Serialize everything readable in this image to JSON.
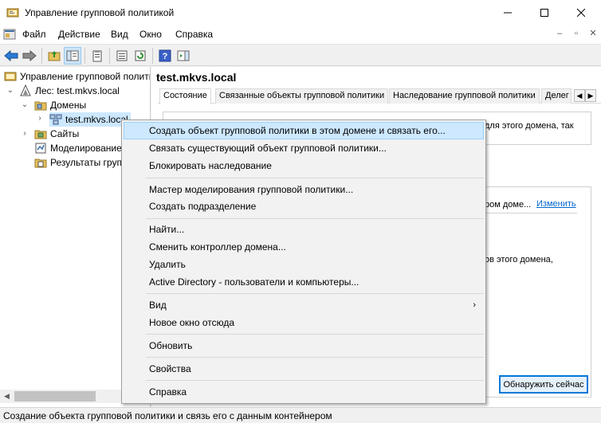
{
  "window": {
    "title": "Управление групповой политикой"
  },
  "menubar": {
    "items": [
      "Файл",
      "Действие",
      "Вид",
      "Окно",
      "Справка"
    ]
  },
  "tree": {
    "root": "Управление групповой полити",
    "forest": "Лес: test.mkvs.local",
    "domains": "Домены",
    "domain": "test.mkvs.local",
    "sites": "Сайты",
    "modeling": "Моделирование",
    "results": "Результаты груп"
  },
  "right": {
    "header": "test.mkvs.local",
    "tabs": [
      "Состояние",
      "Связанные объекты групповой политики",
      "Наследование групповой политики",
      "Делег"
    ],
    "text1": "для этого домена, так",
    "text2": "ром доме...",
    "link_change": "Изменить",
    "text3": "ов этого домена,",
    "detect_button": "Обнаружить сейчас"
  },
  "context_menu": {
    "items": [
      "Создать объект групповой политики в этом домене и связать его...",
      "Связать существующий объект групповой политики...",
      "Блокировать наследование",
      "Мастер моделирования групповой политики...",
      "Создать подразделение",
      "Найти...",
      "Сменить контроллер домена...",
      "Удалить",
      "Active Directory - пользователи и компьютеры...",
      "Вид",
      "Новое окно отсюда",
      "Обновить",
      "Свойства",
      "Справка"
    ]
  },
  "statusbar": {
    "text": "Создание объекта групповой политики и связь его с данным контейнером"
  },
  "colors": {
    "accent": "#0078d7",
    "highlight": "#cde8ff",
    "link": "#0066cc"
  }
}
